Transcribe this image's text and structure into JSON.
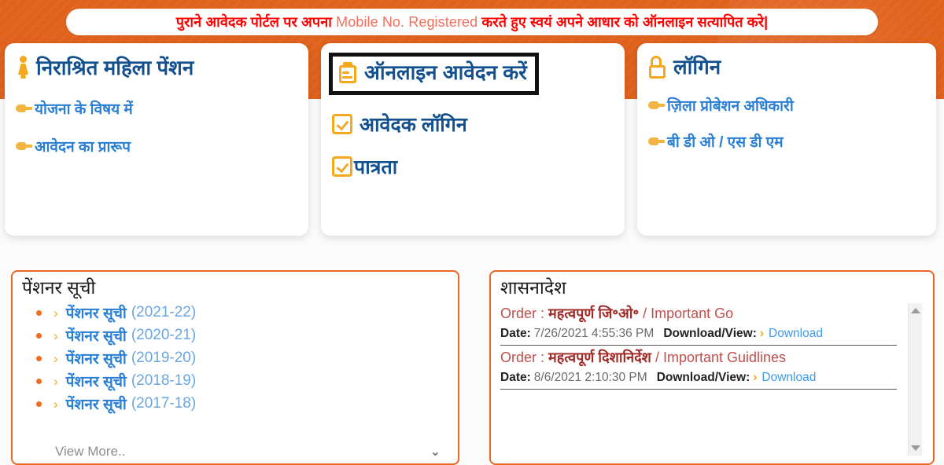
{
  "theme": {
    "brand_orange": "#e0621d",
    "accent_orange": "#f5a81c",
    "link_blue": "#2a7fd4",
    "heading_blue": "#12508f",
    "notice_red": "#fe0000",
    "order_red": "#c0504d"
  },
  "notice": {
    "text_part1": "पुराने आवेदक पोर्टल पर अपना ",
    "text_en": "Mobile No. Registered",
    "text_part2": " करते हुए स्वयं अपने आधार को ऑनलाइन सत्यापित करे|",
    "full_text": "पुराने आवेदक पोर्टल पर अपना Mobile No. Registered करते हुए स्वयं अपने आधार को ऑनलाइन सत्यापित करे|"
  },
  "cards": [
    {
      "id": "scheme-card",
      "icon": "female-person-icon",
      "title": "निराश्रित महिला पेंशन",
      "links": [
        {
          "icon": "hand-pointing-icon",
          "label": "योजना के विषय में"
        },
        {
          "icon": "hand-pointing-icon",
          "label": "आवेदन का प्रारूप"
        }
      ]
    },
    {
      "id": "apply-card",
      "icon": "clipboard-icon",
      "title": "ऑनलाइन आवेदन करें",
      "focused": true,
      "links": [
        {
          "icon": "checkbox-checked-icon",
          "label": "आवेदक लॉगिन"
        },
        {
          "icon": "checkbox-checked-icon",
          "label": "पात्रता"
        }
      ]
    },
    {
      "id": "login-card",
      "icon": "open-padlock-icon",
      "title": "लॉगिन",
      "links": [
        {
          "icon": "hand-pointing-icon",
          "label": "ज़िला प्रोबेशन अधिकारी"
        },
        {
          "icon": "hand-pointing-icon",
          "label": "बी डी ओ / एस डी एम"
        }
      ]
    }
  ],
  "pensioner_panel": {
    "heading": "पेंशनर सूची",
    "items": [
      {
        "label": "पेंशनर सूची ",
        "year": "(2021-22)"
      },
      {
        "label": "पेंशनर सूची ",
        "year": "(2020-21)"
      },
      {
        "label": "पेंशनर सूची ",
        "year": "(2019-20)"
      },
      {
        "label": "पेंशनर सूची ",
        "year": "(2018-19)"
      },
      {
        "label": "पेंशनर सूची ",
        "year": "(2017-18)"
      }
    ],
    "view_more_label": "View More..",
    "view_more_icon": "chevron-down-icon"
  },
  "orders_panel": {
    "heading": "शासनादेश",
    "order_prefix": "Order : ",
    "date_label": "Date:",
    "download_label": "Download/View:",
    "download_link": "Download",
    "orders": [
      {
        "title_hi": "महत्वपूर्ण जि॰ओ॰",
        "title_sep": " / ",
        "title_en": "Important Go",
        "date": "7/26/2021 4:55:36 PM"
      },
      {
        "title_hi": "महत्वपूर्ण दिशानिर्देश",
        "title_sep": " / ",
        "title_en": "Important Guidlines",
        "date": "8/6/2021 2:10:30 PM"
      }
    ],
    "scrollbar": {
      "up_icon": "scroll-up-arrow-icon",
      "down_icon": "scroll-down-arrow-icon"
    }
  }
}
